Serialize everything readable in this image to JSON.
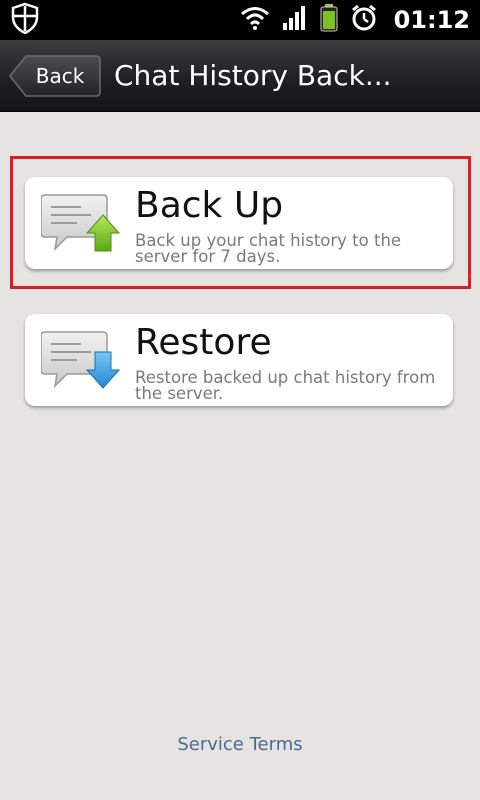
{
  "status_bar": {
    "time": "01:12",
    "icons": [
      "shield-icon",
      "wifi-icon",
      "signal-icon",
      "battery-icon",
      "alarm-icon"
    ]
  },
  "header": {
    "back_label": "Back",
    "title": "Chat History Back..."
  },
  "options": [
    {
      "title": "Back Up",
      "description": "Back up your chat history to the server for 7 days.",
      "icon": "chat-upload-icon",
      "arrow_color": "#7cc322",
      "highlighted": true
    },
    {
      "title": "Restore",
      "description": "Restore backed up chat history from the server.",
      "icon": "chat-download-icon",
      "arrow_color": "#2f9be0",
      "highlighted": false
    }
  ],
  "footer": {
    "service_terms": "Service Terms"
  },
  "colors": {
    "highlight": "#e01b24",
    "link": "#4b6a92",
    "background": "#e6e4e2"
  }
}
